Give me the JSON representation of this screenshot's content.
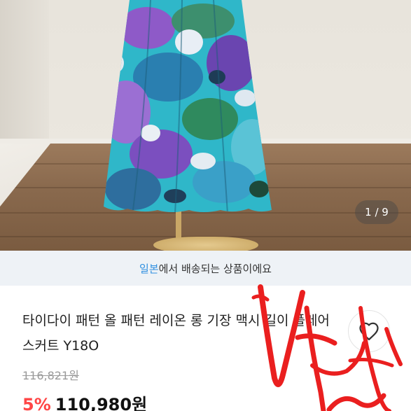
{
  "product": {
    "image_counter": "1 / 9",
    "shipping": {
      "country": "일본",
      "suffix": "에서 배송되는 상품이에요"
    },
    "title": "타이다이 패턴 올 패턴 레이온 롱 기장 맥시 길이 플레어 스커트 Y18O",
    "original_price": "116,821원",
    "discount": "5%",
    "price": "110,980원"
  },
  "icons": {
    "wishlist": "heart-outline-icon"
  },
  "colors": {
    "accent_red": "#ff4646",
    "country_blue": "#2f8fe0",
    "notice_bg": "#eef2f6"
  }
}
